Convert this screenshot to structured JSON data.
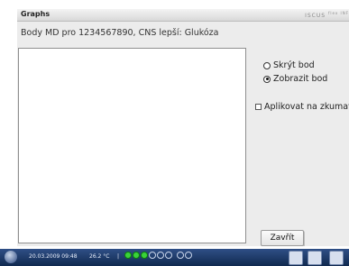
{
  "window": {
    "title": "Graphs",
    "brand": "ISCUS",
    "brand_suffix": "flex  INF",
    "subtitle": "Body MD pro 1234567890, CNS lepší: Glukóza"
  },
  "options": {
    "hide_point": "Skrýt bod",
    "show_point": "Zobrazit bod",
    "apply_label": "Aplikovat na zkumavku",
    "selected": "show_point"
  },
  "buttons": {
    "close_label": "Zavřít"
  },
  "taskbar": {
    "datetime": "20.03.2009 09:48",
    "temperature": "26.2 °C",
    "separator": "|",
    "leds_on": 3,
    "leds_total": 6
  },
  "colors": {
    "taskbar": "#1c3a6c",
    "led_on": "#3ad23a"
  }
}
